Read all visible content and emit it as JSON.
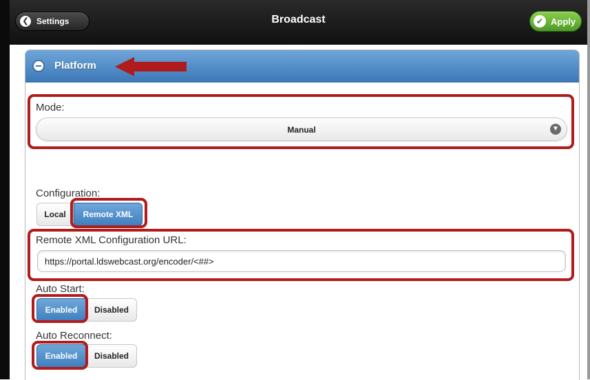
{
  "header": {
    "back_label": "Settings",
    "title": "Broadcast",
    "apply_label": "Apply"
  },
  "panel": {
    "title": "Platform"
  },
  "mode": {
    "label": "Mode:",
    "value": "Manual"
  },
  "configuration": {
    "label": "Configuration:",
    "options": [
      "Local",
      "Remote XML"
    ],
    "selected": "Remote XML"
  },
  "remote_url": {
    "label": "Remote XML Configuration URL:",
    "value": "https://portal.ldswebcast.org/encoder/<##>"
  },
  "auto_start": {
    "label": "Auto Start:",
    "options": [
      "Enabled",
      "Disabled"
    ],
    "selected": "Enabled"
  },
  "auto_reconnect": {
    "label": "Auto Reconnect:",
    "options": [
      "Enabled",
      "Disabled"
    ],
    "selected": "Enabled"
  },
  "colors": {
    "accent_blue": "#3d79b8",
    "apply_green": "#4c9a26",
    "highlight_red": "#b01c1c"
  }
}
